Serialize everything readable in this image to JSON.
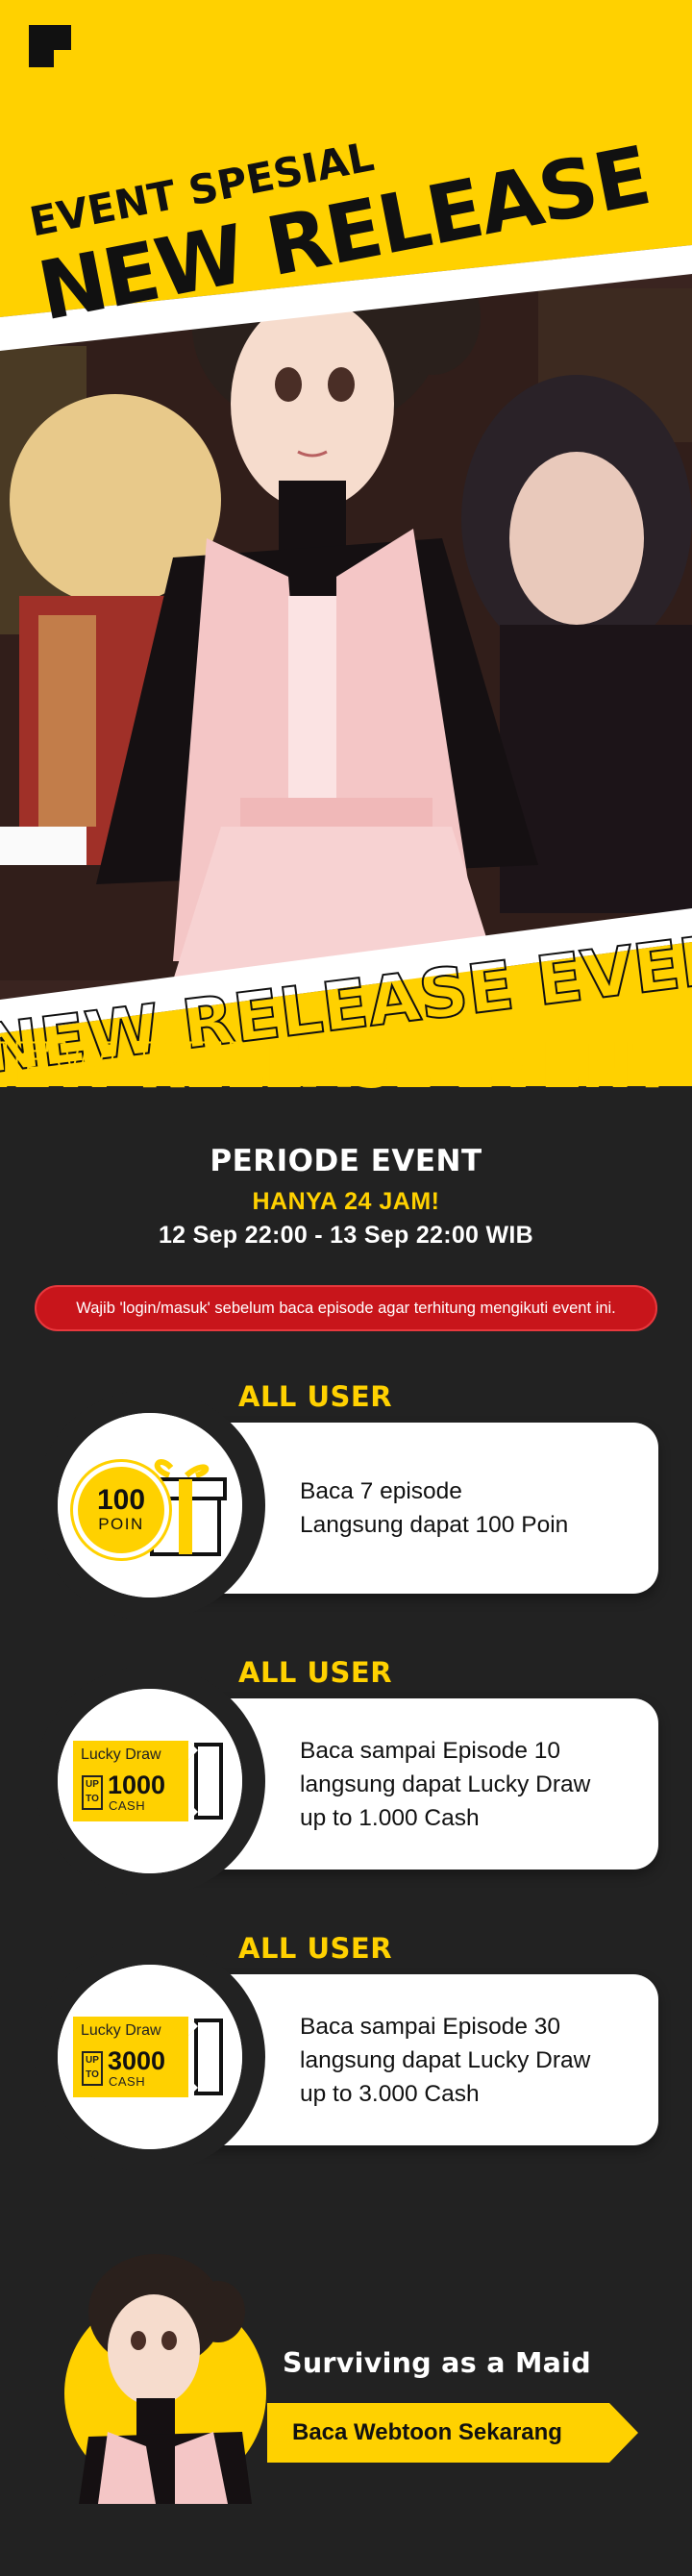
{
  "hero": {
    "logo": "square-corner-logo",
    "kicker": "EVENT SPESIAL",
    "title": "NEW RELEASE",
    "ribbon_text": "NEW RELEASE EVENT NEW RELEASE EVENT NEW RELEASE EVENT"
  },
  "period": {
    "title": "PERIODE EVENT",
    "highlight": "HANYA 24 JAM!",
    "dates": "12 Sep 22:00 - 13 Sep 22:00 WIB"
  },
  "notice": "Wajib 'login/masuk' sebelum baca episode agar terhitung mengikuti event ini.",
  "rewards": [
    {
      "badge": "ALL USER",
      "icon": "coin-gift-icon",
      "coin_amount": "100",
      "coin_unit": "POIN",
      "lines": [
        "Baca 7 episode",
        "Langsung dapat 100 Poin"
      ]
    },
    {
      "badge": "ALL USER",
      "icon": "lucky-draw-ticket-icon",
      "ticket_label": "Lucky Draw",
      "ticket_upto": "UP TO",
      "ticket_amount": "1000",
      "ticket_unit": "CASH",
      "lines": [
        "Baca sampai Episode 10",
        "langsung dapat Lucky Draw",
        "up to 1.000 Cash"
      ]
    },
    {
      "badge": "ALL USER",
      "icon": "lucky-draw-ticket-icon",
      "ticket_label": "Lucky Draw",
      "ticket_upto": "UP TO",
      "ticket_amount": "3000",
      "ticket_unit": "CASH",
      "lines": [
        "Baca sampai Episode 30",
        "langsung dapat Lucky Draw",
        "up to 3.000 Cash"
      ]
    }
  ],
  "cta": {
    "title": "Surviving as a Maid",
    "button_label": "Baca Webtoon Sekarang"
  },
  "colors": {
    "background": "#222222",
    "accent": "#ffd100",
    "notice": "#c8151b",
    "card": "#ffffff"
  }
}
